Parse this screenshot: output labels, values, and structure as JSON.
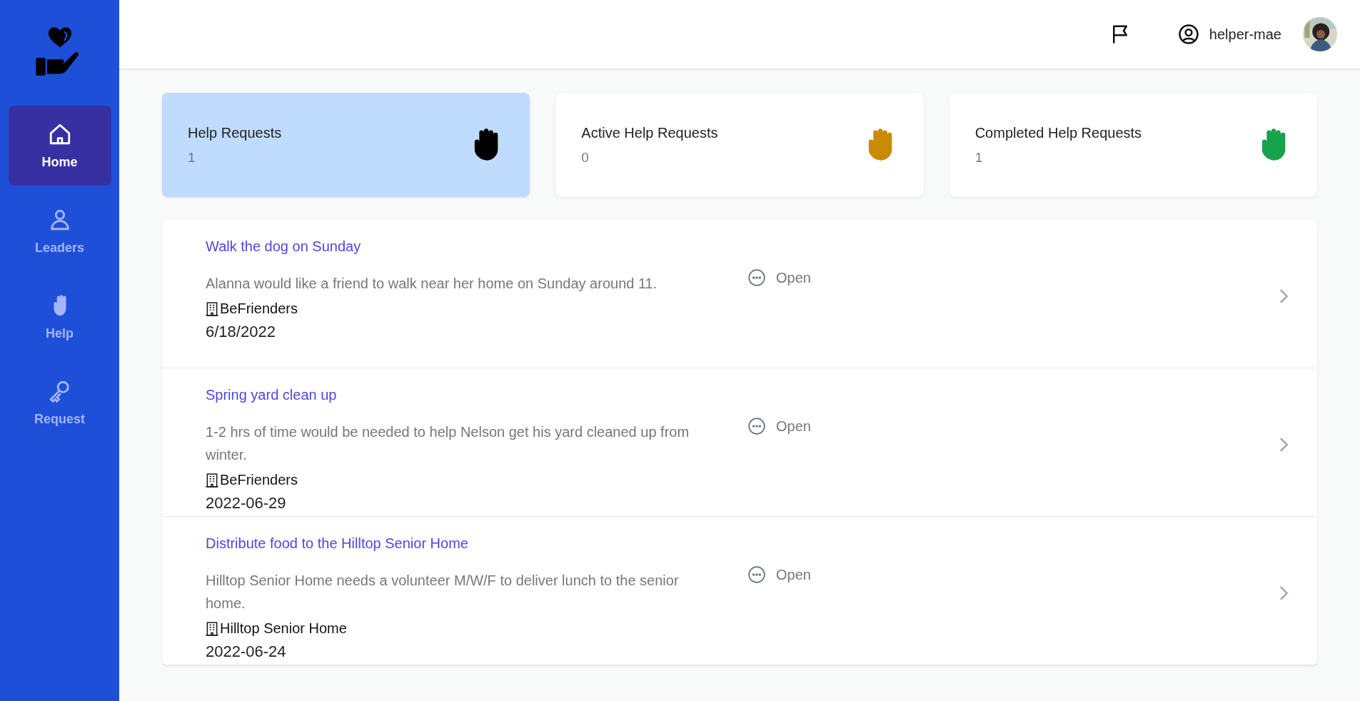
{
  "sidebar": {
    "items": [
      {
        "label": "Home",
        "selected": true
      },
      {
        "label": "Leaders",
        "selected": false
      },
      {
        "label": "Help",
        "selected": false
      },
      {
        "label": "Request",
        "selected": false
      }
    ]
  },
  "header": {
    "username": "helper-mae"
  },
  "stats": [
    {
      "title": "Help Requests",
      "count": "1",
      "color": "#000000",
      "selected": true
    },
    {
      "title": "Active Help Requests",
      "count": "0",
      "color": "#ca8a04",
      "selected": false
    },
    {
      "title": "Completed Help Requests",
      "count": "1",
      "color": "#16a34a",
      "selected": false
    }
  ],
  "requests": [
    {
      "title": "Walk the dog on Sunday",
      "description": "Alanna would like a friend to walk near her home on Sunday around 11.",
      "organization": "BeFrienders",
      "date": "6/18/2022",
      "status": "Open"
    },
    {
      "title": "Spring yard clean up",
      "description": "1-2 hrs of time would be needed to help Nelson get his yard cleaned up from winter.",
      "organization": "BeFrienders",
      "date": "2022-06-29",
      "status": "Open"
    },
    {
      "title": "Distribute food to the Hilltop Senior Home",
      "description": "Hilltop Senior Home needs a volunteer M/W/F to deliver lunch to the senior home.",
      "organization": "Hilltop Senior Home",
      "date": "2022-06-24",
      "status": "Open"
    }
  ]
}
